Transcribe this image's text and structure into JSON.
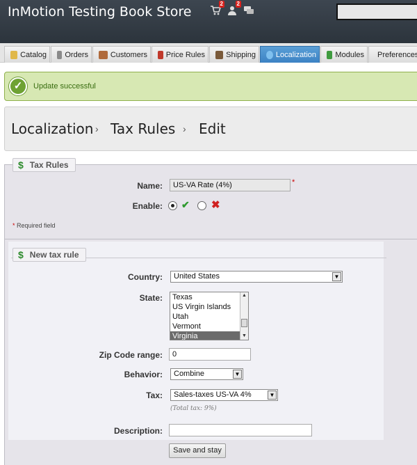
{
  "header": {
    "shop_name": "InMotion Testing Book Store",
    "notifications": [
      {
        "icon": "cart-icon",
        "count": "2"
      },
      {
        "icon": "customer-icon",
        "count": "2"
      },
      {
        "icon": "message-icon",
        "count": ""
      }
    ],
    "search_value": ""
  },
  "tabs": [
    {
      "label": "Catalog",
      "icon": "folder-icon",
      "color": "#e0b84a"
    },
    {
      "label": "Orders",
      "icon": "cart-icon",
      "color": "#8a8a8a"
    },
    {
      "label": "Customers",
      "icon": "customer-icon",
      "color": "#b06a3b"
    },
    {
      "label": "Price Rules",
      "icon": "price-tag-icon",
      "color": "#c0392b"
    },
    {
      "label": "Shipping",
      "icon": "truck-icon",
      "color": "#7a5a3a"
    },
    {
      "label": "Localization",
      "icon": "globe-icon",
      "color": "#7fc0ef"
    },
    {
      "label": "Modules",
      "icon": "puzzle-icon",
      "color": "#3f9b3f"
    },
    {
      "label": "Preferences",
      "icon": "preferences-icon",
      "color": "#4a7fb5"
    }
  ],
  "alert": {
    "message": "Update successful",
    "icon": "check-circle-icon"
  },
  "breadcrumb": {
    "items": [
      "Localization",
      "Tax Rules",
      "Edit"
    ],
    "separator": "›"
  },
  "tax_rules_fieldset": {
    "legend": "Tax Rules",
    "name_label": "Name:",
    "name_value": "US-VA Rate (4%)",
    "required_mark": "*",
    "enable_label": "Enable:",
    "enabled": true,
    "required_note": "Required field"
  },
  "new_rule_fieldset": {
    "legend": "New tax rule",
    "country_label": "Country:",
    "country_value": "United States",
    "state_label": "State:",
    "state_options": [
      "Texas",
      "US Virgin Islands",
      "Utah",
      "Vermont",
      "Virginia"
    ],
    "state_selected": "Virginia",
    "zip_label": "Zip Code range:",
    "zip_value": "0",
    "behavior_label": "Behavior:",
    "behavior_value": "Combine",
    "tax_label": "Tax:",
    "tax_value": "Sales-taxes US-VA 4%",
    "total_tax": "(Total tax: 9%)",
    "description_label": "Description:",
    "description_value": "",
    "save_button": "Save and stay"
  },
  "colors": {
    "header_bg": "#374049",
    "accent_blue": "#3c82c4",
    "success_bg": "#d7e8b3",
    "success_text": "#386c0f",
    "required": "#c00"
  }
}
